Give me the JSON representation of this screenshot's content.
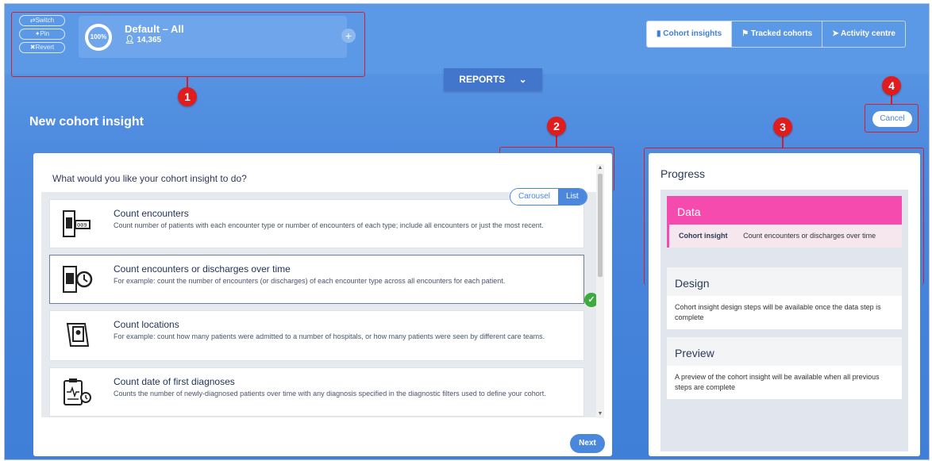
{
  "topbar": {
    "switch_label": "⇄Switch",
    "pin_label": "✦Pin",
    "revert_label": "✖Revert",
    "cohort": {
      "percent": "100%",
      "name": "Default – All",
      "count": "14,365"
    },
    "nav": [
      {
        "label": "Cohort insights",
        "icon": "bar-chart-icon"
      },
      {
        "label": "Tracked cohorts",
        "icon": "flag-icon"
      },
      {
        "label": "Activity centre",
        "icon": "send-icon"
      }
    ]
  },
  "reports_label": "REPORTS",
  "page_title": "New cohort insight",
  "cancel_label": "Cancel",
  "annotations": [
    "1",
    "2",
    "3",
    "4"
  ],
  "main": {
    "question": "What would you like your cohort insight to do?",
    "toggle": {
      "carousel": "Carousel",
      "list": "List"
    },
    "items": [
      {
        "title": "Count encounters",
        "desc": "Count number of patients with each encounter type or number of encounters of each type; include all encounters or just the most recent."
      },
      {
        "title": "Count encounters or discharges over time",
        "desc": "For example: count the number of encounters (or discharges) of each encounter type across all encounters for each patient."
      },
      {
        "title": "Count locations",
        "desc": "For example: count how many patients were admitted to a number of hospitals, or how many patients were seen by different care teams."
      },
      {
        "title": "Count date of first diagnoses",
        "desc": "Counts the number of newly-diagnosed patients over time with any diagnosis specified in the diagnostic filters used to define your cohort."
      }
    ],
    "selected_index": 1,
    "next_label": "Next"
  },
  "progress": {
    "title": "Progress",
    "data": {
      "heading": "Data",
      "key": "Cohort insight",
      "value": "Count encounters or discharges over time"
    },
    "design": {
      "heading": "Design",
      "text": "Cohort insight design steps will be available once the data step is complete"
    },
    "preview": {
      "heading": "Preview",
      "text": "A preview of the cohort insight will be available when all previous steps are complete"
    }
  },
  "colors": {
    "accent": "#4a87dd",
    "data_step": "#f54bae",
    "annotation": "#e01c1c",
    "check": "#3caa3c"
  }
}
